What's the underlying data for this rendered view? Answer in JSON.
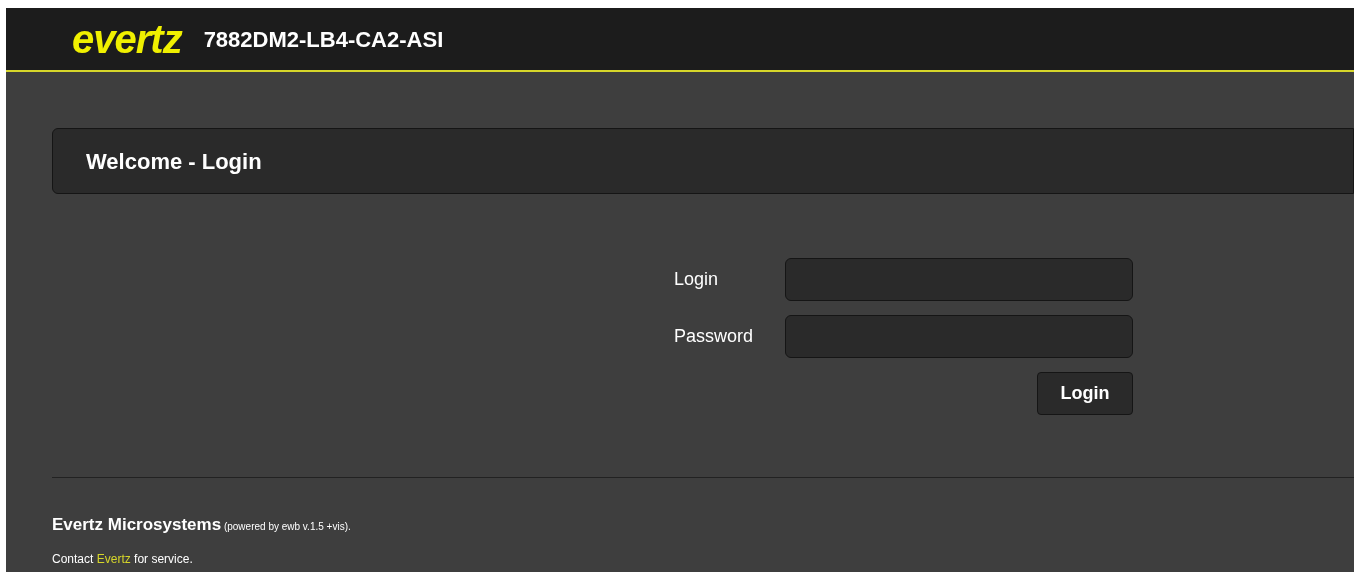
{
  "header": {
    "logo": "evertz",
    "device_name": "7882DM2-LB4-CA2-ASI"
  },
  "panel": {
    "title": "Welcome - Login"
  },
  "form": {
    "fields": [
      {
        "label": "Login"
      },
      {
        "label": "Password"
      }
    ],
    "submit": "Login"
  },
  "footer": {
    "company": "Evertz Microsystems",
    "version": "(powered by ewb v.1.5 +vis).",
    "contact_before": "Contact",
    "contact_link": "Evertz",
    "contact_after": "for service."
  }
}
